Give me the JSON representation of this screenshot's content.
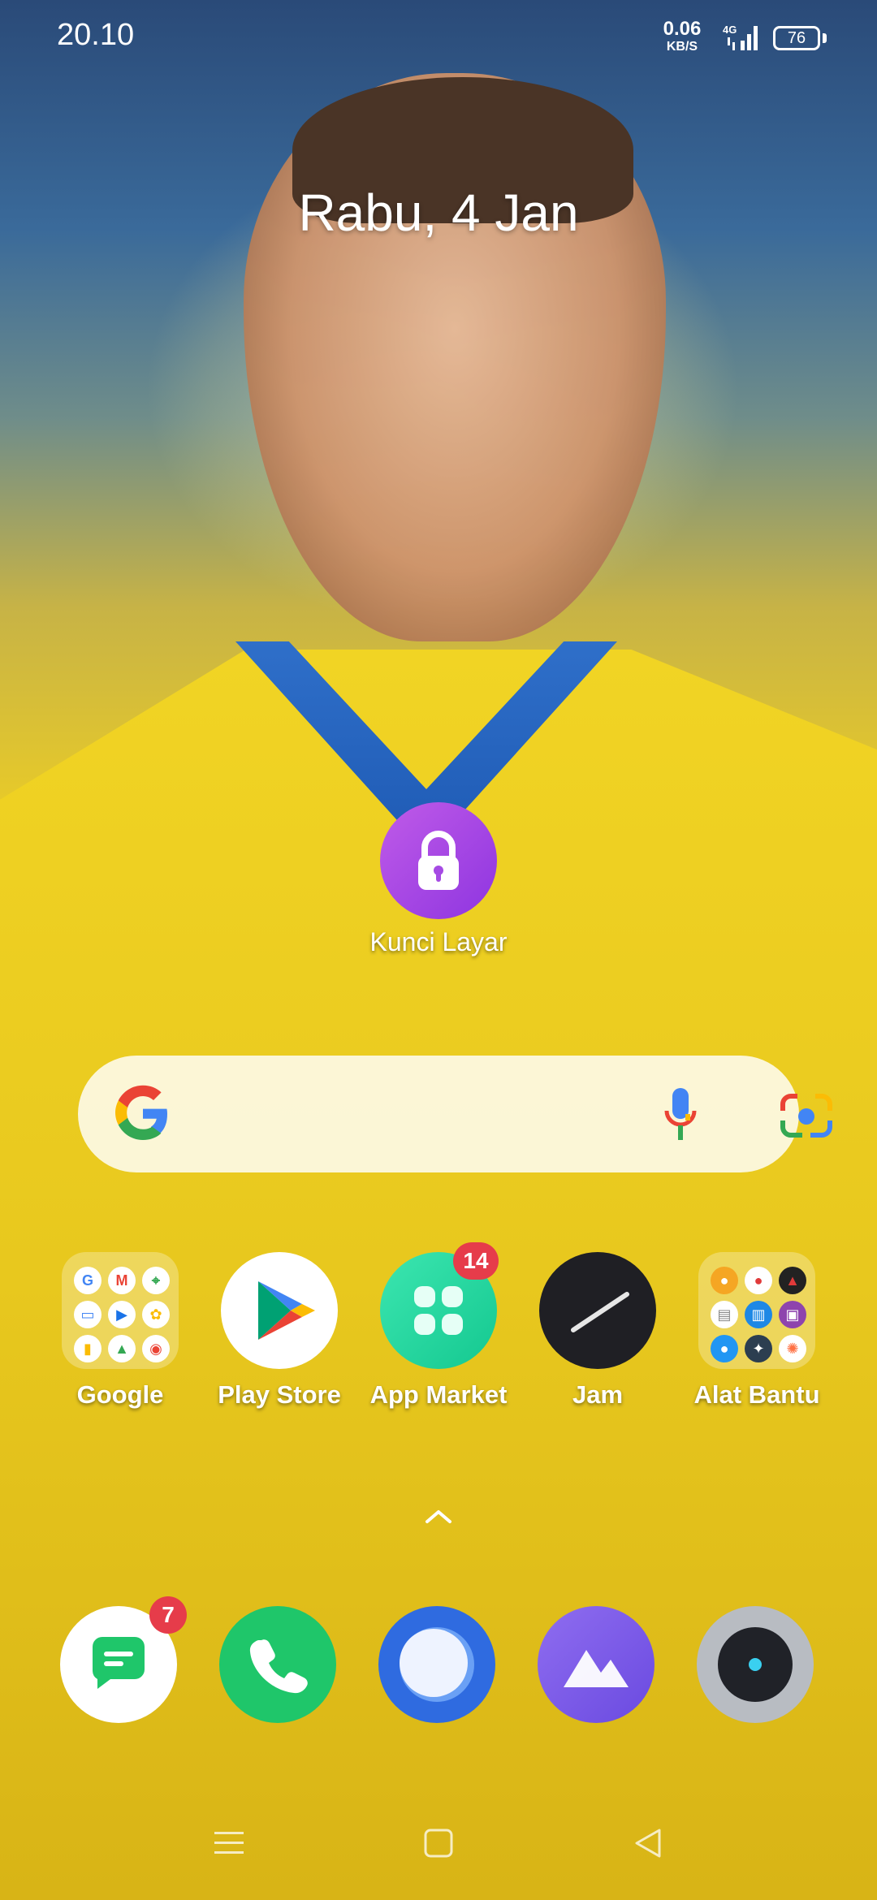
{
  "status_bar": {
    "time": "20.10",
    "net_speed_value": "0.06",
    "net_speed_unit": "KB/S",
    "network_type": "4G",
    "battery": "76"
  },
  "lock_screen": {
    "date": "Rabu, 4 Jan"
  },
  "widgets": {
    "lock_label": "Kunci Layar"
  },
  "search_bar": {
    "icons": [
      "google-icon",
      "mic-icon",
      "lens-icon"
    ]
  },
  "apps": [
    {
      "label": "Google",
      "type": "folder"
    },
    {
      "label": "Play Store"
    },
    {
      "label": "App Market",
      "badge": "14"
    },
    {
      "label": "Jam"
    },
    {
      "label": "Alat Bantu",
      "type": "folder"
    }
  ],
  "dock": [
    {
      "name": "messages",
      "badge": "7"
    },
    {
      "name": "phone"
    },
    {
      "name": "browser"
    },
    {
      "name": "gallery"
    },
    {
      "name": "camera"
    }
  ],
  "colors": {
    "accent_badge": "#e63c4a",
    "lock_purple": "#a64ae4",
    "phone_green": "#1fc66a"
  }
}
